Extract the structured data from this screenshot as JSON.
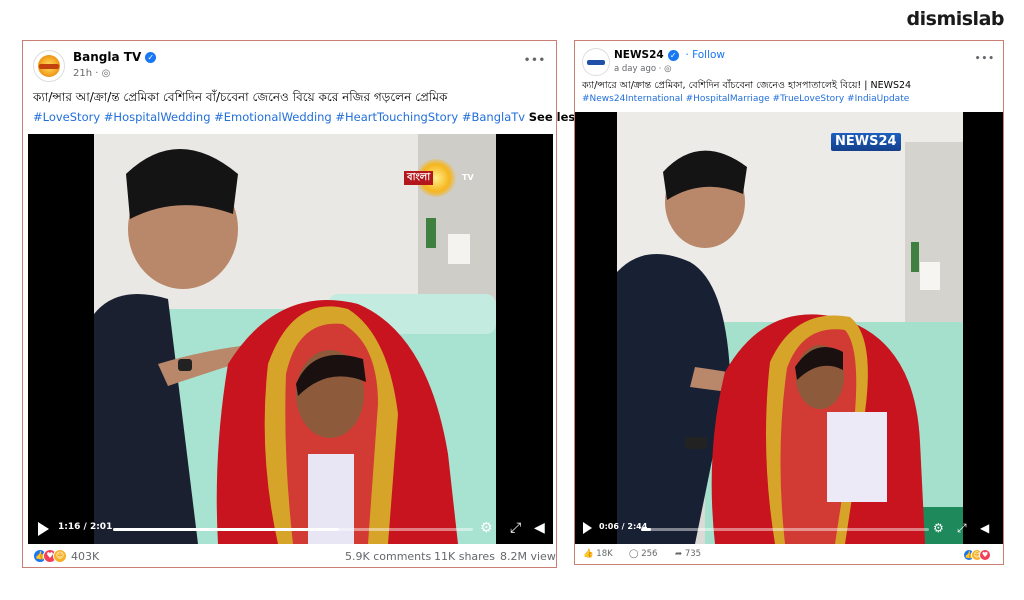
{
  "watermark": "dismislab",
  "post1": {
    "page_name": "Bangla TV",
    "time": "21h",
    "more": "•••",
    "caption": "ক্যা/ন্সার আ/ক্রা/ন্ত প্রেমিকা বেশিদিন বাঁ/চবেনা জেনেও বিয়ে করে নজির গড়লেন প্রেমিক",
    "hashtags": "#LoveStory #HospitalWedding #EmotionalWedding #HeartTouchingStory #BanglaTv",
    "see_less": "See less",
    "channel_logo": "বাংলা",
    "channel_logo_tag": "TV",
    "video_time": "1:16 / 2:01",
    "progress": 0.628,
    "reactions_count": "403K",
    "comments": "5.9K comments",
    "shares": "11K shares",
    "views": "8.2M view"
  },
  "post2": {
    "page_name": "NEWS24",
    "follow": "Follow",
    "time": "a day ago",
    "more": "•••",
    "caption": "ক্যা/ন্সারে আ/ক্রান্ত প্রেমিকা, বেশিদিন বাঁচবেনা জেনেও হাসপাতালেই বিয়ে! | NEWS24",
    "hashtags": "#News24International #HospitalMarriage #TrueLoveStory #IndiaUpdate",
    "channel_logo": "NEWS24",
    "video_time": "0:06 / 2:44",
    "progress": 0.036,
    "likes": "18K",
    "comments": "256",
    "shares": "735"
  },
  "colors": {
    "fb_blue": "#1877f2",
    "hashtag": "#216fdb",
    "border": "#c97f74",
    "muted": "#65676b"
  }
}
